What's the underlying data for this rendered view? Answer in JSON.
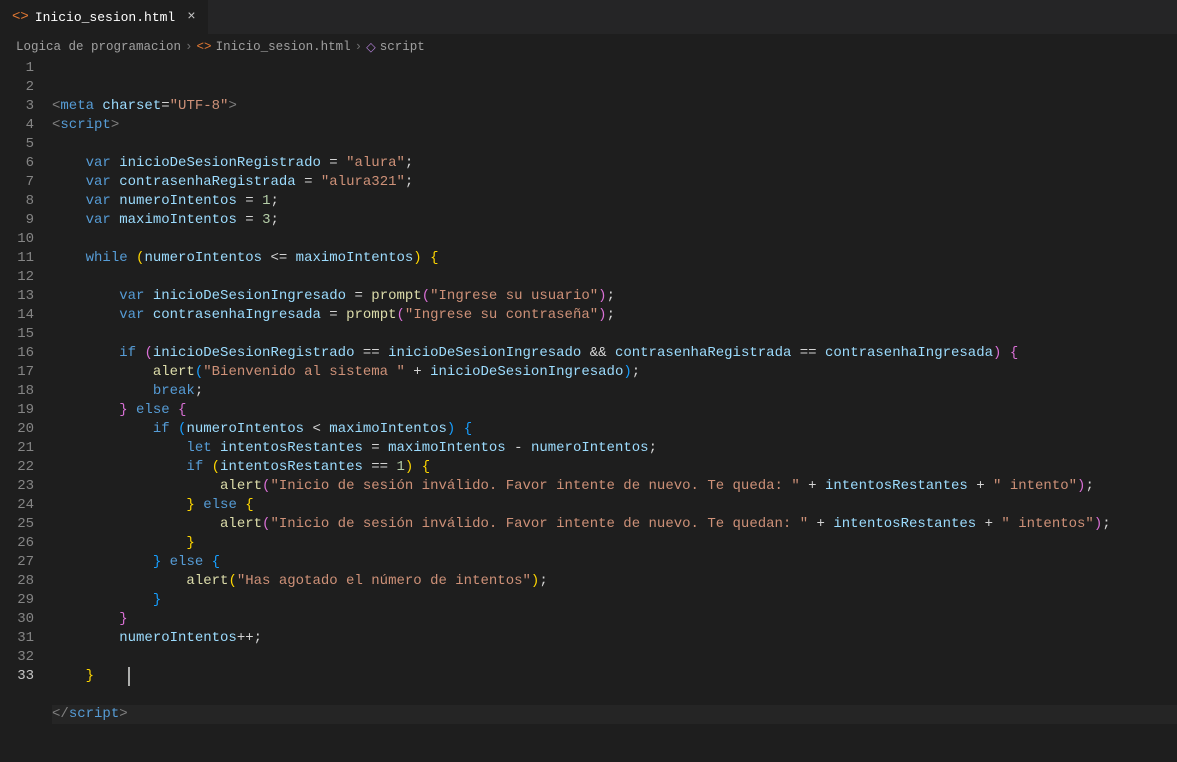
{
  "tab": {
    "icon": "<>",
    "title": "Inicio_sesion.html",
    "close": "×"
  },
  "breadcrumb": {
    "folder": "Logica de programacion",
    "sep": "›",
    "file_icon": "<>",
    "file": "Inicio_sesion.html",
    "sym_icon": "◇",
    "symbol": "script"
  },
  "lines": {
    "count": 33,
    "active": 33
  },
  "code": {
    "meta_tag": "meta",
    "charset_attr": "charset",
    "charset_val": "\"UTF-8\"",
    "script_open": "script",
    "script_close": "script",
    "var_kw": "var",
    "let_kw": "let",
    "while_kw": "while",
    "if_kw": "if",
    "else_kw": "else",
    "break_kw": "break",
    "v_inicioReg": "inicioDeSesionRegistrado",
    "v_contraReg": "contrasenhaRegistrada",
    "v_numInt": "numeroIntentos",
    "v_maxInt": "maximoIntentos",
    "v_inicioIng": "inicioDeSesionIngresado",
    "v_contraIng": "contrasenhaIngresada",
    "v_intRest": "intentosRestantes",
    "fn_prompt": "prompt",
    "fn_alert": "alert",
    "s_alura": "\"alura\"",
    "s_alura321": "\"alura321\"",
    "s_usuario": "\"Ingrese su usuario\"",
    "s_contra": "\"Ingrese su contraseña\"",
    "s_bienv": "\"Bienvenido al sistema \"",
    "s_inv1": "\"Inicio de sesión inválido. Favor intente de nuevo. Te queda: \"",
    "s_inv1b": "\" intento\"",
    "s_inv2": "\"Inicio de sesión inválido. Favor intente de nuevo. Te quedan: \"",
    "s_inv2b": "\" intentos\"",
    "s_agot": "\"Has agotado el número de intentos\"",
    "n_1": "1",
    "n_3": "3"
  }
}
